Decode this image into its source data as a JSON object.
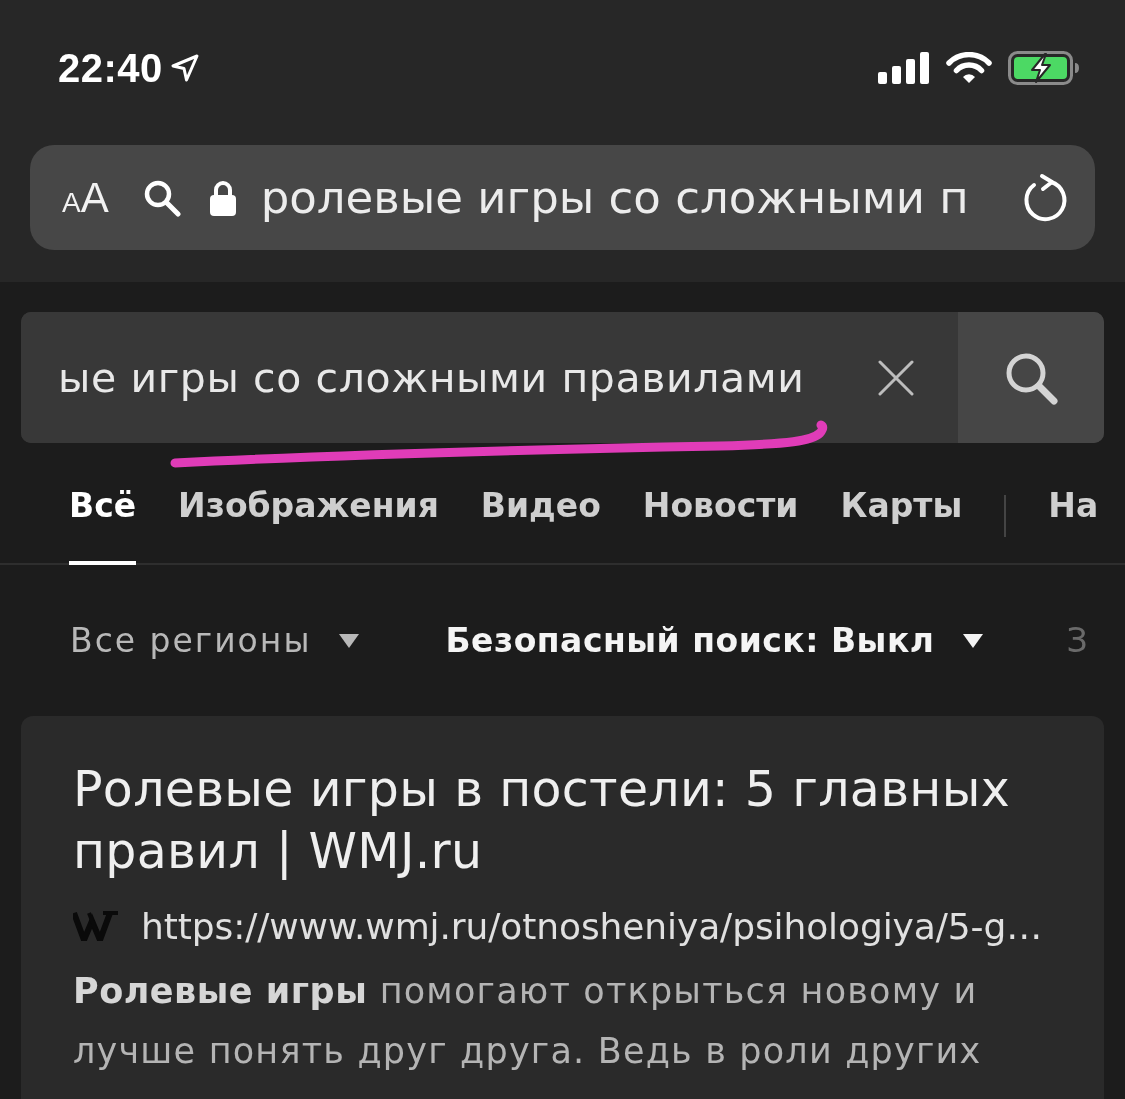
{
  "status_bar": {
    "time": "22:40"
  },
  "address_bar": {
    "reader_button": "AA",
    "url_text": "ролевые игры со сложными п"
  },
  "search": {
    "value": "ые игры со сложными правилами"
  },
  "tabs": [
    {
      "label": "Всё",
      "selected": true,
      "divider_before": false
    },
    {
      "label": "Изображения",
      "selected": false,
      "divider_before": false
    },
    {
      "label": "Видео",
      "selected": false,
      "divider_before": false
    },
    {
      "label": "Новости",
      "selected": false,
      "divider_before": false
    },
    {
      "label": "Карты",
      "selected": false,
      "divider_before": false
    },
    {
      "label": "На",
      "selected": false,
      "divider_before": true
    }
  ],
  "filters": [
    {
      "kind": "dropdown",
      "label": "Все регионы",
      "active": false
    },
    {
      "kind": "dropdown",
      "label": "Безопасный поиск: Выкл",
      "active": true
    },
    {
      "kind": "text",
      "label": "З"
    }
  ],
  "results": [
    {
      "title": "Ролевые игры в постели: 5 главных правил | WMJ.ru",
      "url": "https://www.wmj.ru/otnosheniya/psihologiya/5-g…",
      "snippet": "**Ролевые игры** помогают открыться новому и лучше понять друг друга. Ведь в роли других"
    }
  ]
}
